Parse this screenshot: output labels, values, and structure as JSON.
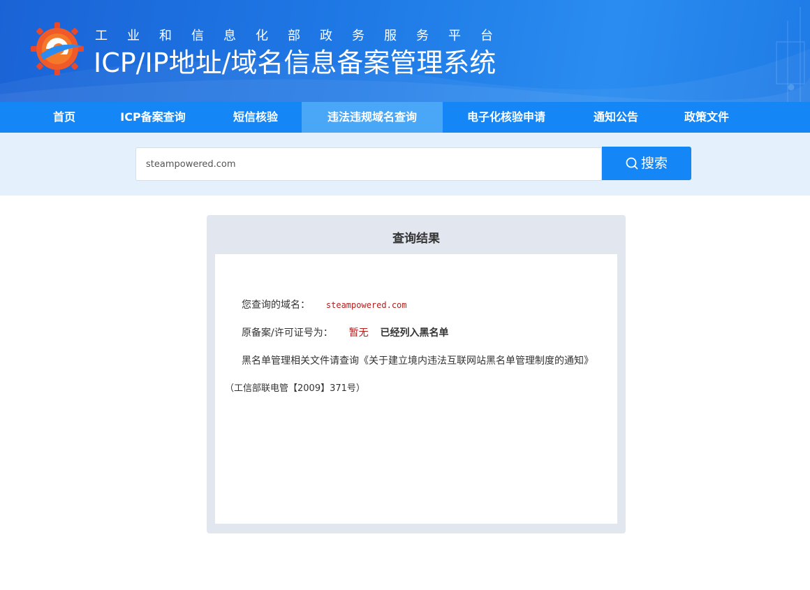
{
  "header": {
    "subtitle": "工业和信息化部政务服务平台",
    "title": "ICP/IP地址/域名信息备案管理系统"
  },
  "nav": {
    "items": [
      {
        "label": "首页",
        "active": false
      },
      {
        "label": "ICP备案查询",
        "active": false
      },
      {
        "label": "短信核验",
        "active": false
      },
      {
        "label": "违法违规域名查询",
        "active": true
      },
      {
        "label": "电子化核验申请",
        "active": false
      },
      {
        "label": "通知公告",
        "active": false
      },
      {
        "label": "政策文件",
        "active": false
      }
    ]
  },
  "search": {
    "value": "steampowered.com",
    "button_label": "搜索",
    "icon": "search-icon"
  },
  "result": {
    "title": "查询结果",
    "domain_label": "您查询的域名：",
    "domain_value": "steampowered.com",
    "license_label": "原备案/许可证号为：",
    "license_value": "暂无",
    "blacklist_status": "已经列入黑名单",
    "notice_line1": "黑名单管理相关文件请查询《关于建立境内违法互联网站黑名单管理制度的通知》",
    "notice_line2": "（工信部联电管【2009】371号）"
  },
  "colors": {
    "header_blue": "#1f7ae6",
    "nav_blue": "#1486f5",
    "nav_active": "#4aa7f7",
    "search_band": "#e4f1fc",
    "panel_gray": "#e2e6ef",
    "value_red": "#b01e1e"
  }
}
